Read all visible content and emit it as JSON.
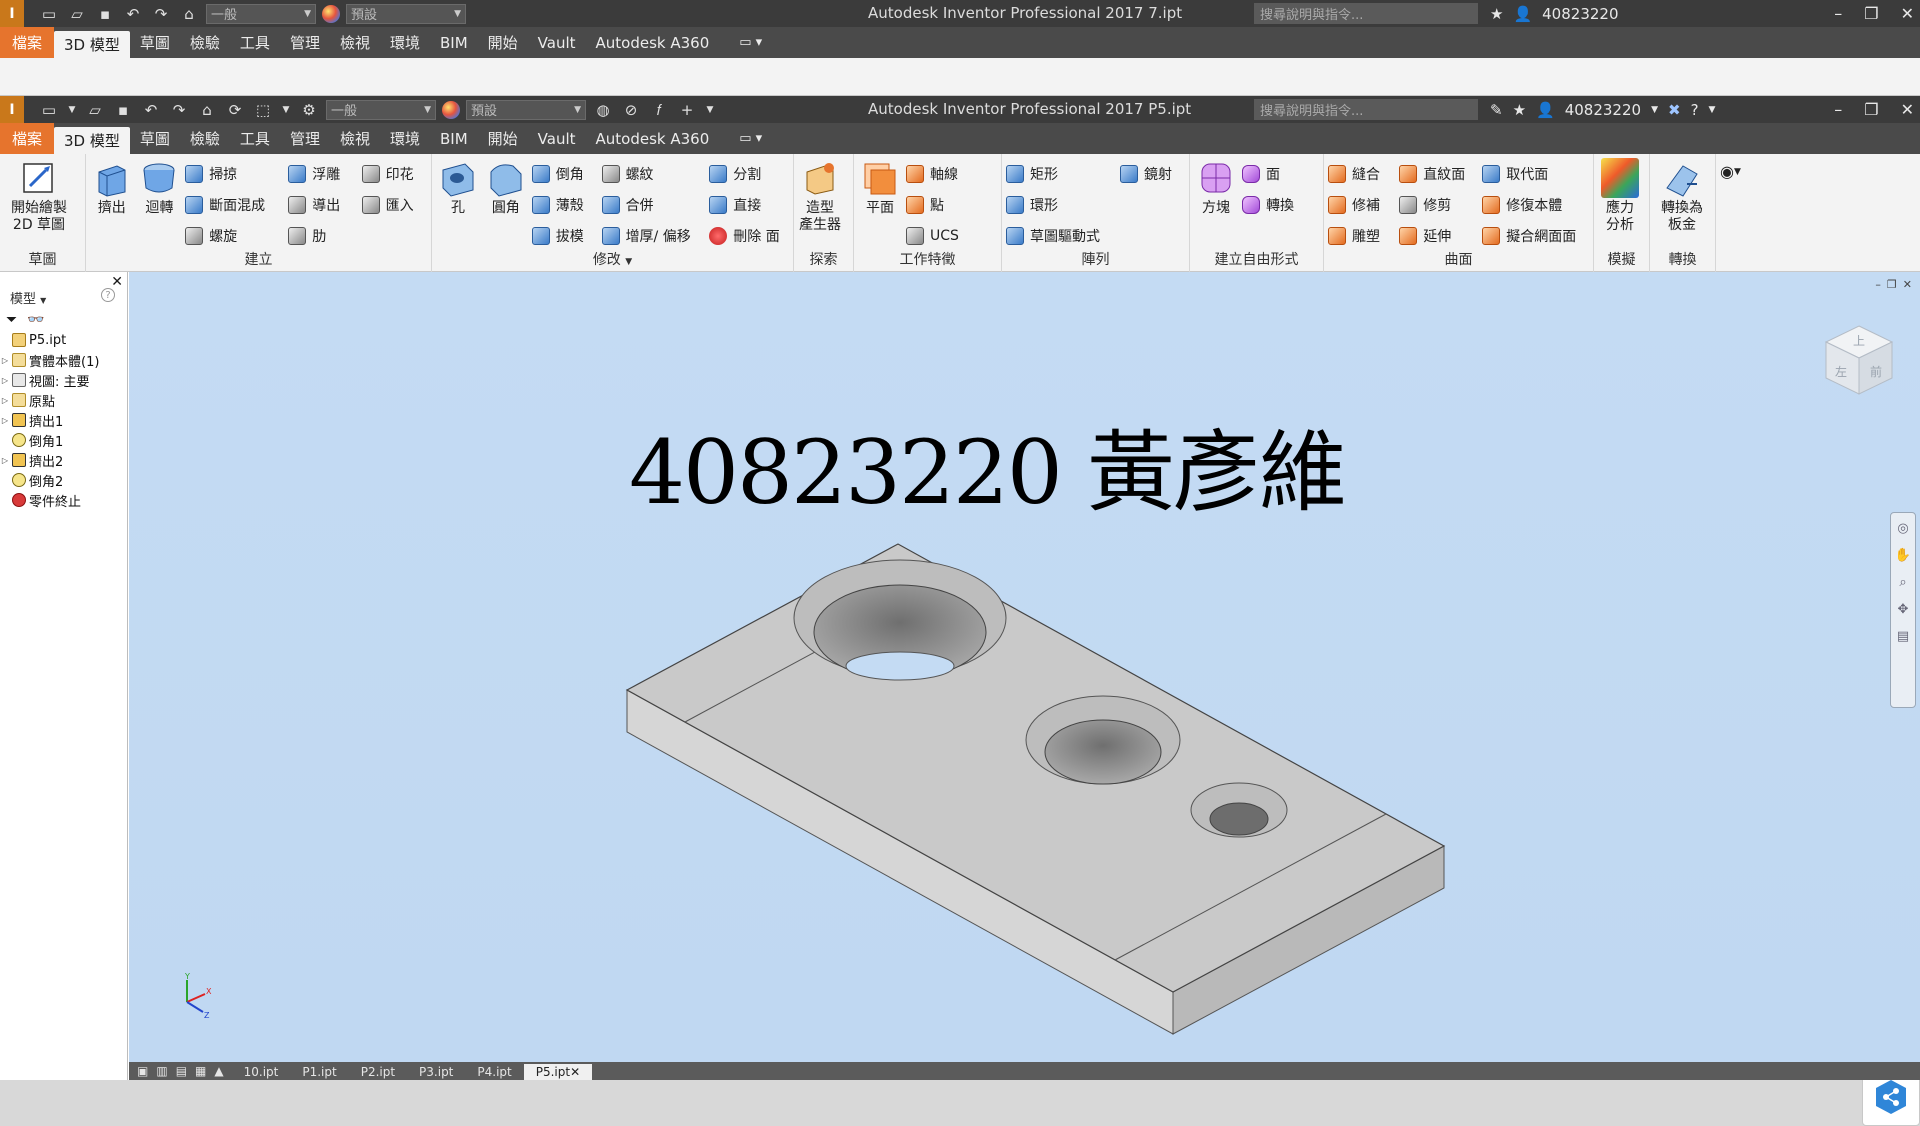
{
  "titlebar": {
    "style_value": "一般",
    "appearance_value": "預設",
    "help_search_placeholder": "搜尋說明與指令...",
    "username": "40823220"
  },
  "ghost_window": {
    "title": "Autodesk Inventor Professional 2017    7.ipt"
  },
  "window": {
    "title": "Autodesk Inventor Professional 2017    P5.ipt"
  },
  "menu_tabs": [
    "檔案",
    "3D 模型",
    "草圖",
    "檢驗",
    "工具",
    "管理",
    "檢視",
    "環境",
    "BIM",
    "開始",
    "Vault",
    "Autodesk A360"
  ],
  "ribbon": {
    "sketch": {
      "title": "草圖",
      "start_2d_sketch": "開始繪製\n2D 草圖"
    },
    "create": {
      "title": "建立",
      "extrude": "擠出",
      "revolve": "迴轉",
      "sweep": "掃掠",
      "loft": "斷面混成",
      "coil": "螺旋",
      "emboss": "浮雕",
      "derive": "導出",
      "rib": "肋",
      "decal": "印花",
      "import": "匯入"
    },
    "modify": {
      "title": "修改",
      "hole": "孔",
      "fillet": "圓角",
      "chamfer": "倒角",
      "shell": "薄殼",
      "draft": "拔模",
      "thread": "螺紋",
      "combine": "合併",
      "thicken_offset": "增厚/ 偏移",
      "split": "分割",
      "direct": "直接",
      "delete_face": "刪除 面"
    },
    "explore": {
      "title": "探索",
      "shape_generator": "造型\n產生器"
    },
    "work_features": {
      "title": "工作特徵",
      "plane": "平面",
      "axis": "軸線",
      "point": "點",
      "ucs": "UCS"
    },
    "pattern": {
      "title": "陣列",
      "rectangular": "矩形",
      "circular": "環形",
      "sketch_driven": "草圖驅動式",
      "mirror": "鏡射"
    },
    "freeform": {
      "title": "建立自由形式",
      "box": "方塊",
      "face": "面",
      "convert": "轉換"
    },
    "surface": {
      "title": "曲面",
      "stitch": "縫合",
      "patch": "修補",
      "sculpt": "雕塑",
      "ruled_surface": "直紋面",
      "trim": "修剪",
      "extend": "延伸",
      "replace_face": "取代面",
      "repair_bodies": "修復本體",
      "fit_mesh_face": "擬合網面面"
    },
    "simulation": {
      "title": "模擬",
      "stress_analysis": "應力\n分析"
    },
    "convert": {
      "title": "轉換",
      "convert_sheet_metal": "轉換為\n板金"
    }
  },
  "browser": {
    "header": "模型",
    "tree": [
      {
        "label": "P5.ipt",
        "icon": "part-doc-icon",
        "expander": false
      },
      {
        "label": "實體本體(1)",
        "icon": "folder-icon",
        "expander": true
      },
      {
        "label": "視圖: 主要",
        "icon": "view-rep-icon",
        "expander": true
      },
      {
        "label": "原點",
        "icon": "folder-icon",
        "expander": true
      },
      {
        "label": "擠出1",
        "icon": "extrude-icon",
        "expander": true
      },
      {
        "label": "倒角1",
        "icon": "chamfer-icon",
        "expander": false
      },
      {
        "label": "擠出2",
        "icon": "extrude-icon",
        "expander": true
      },
      {
        "label": "倒角2",
        "icon": "chamfer-icon",
        "expander": false
      },
      {
        "label": "零件終止",
        "icon": "end-of-part-icon",
        "expander": false
      }
    ]
  },
  "viewport": {
    "overlay_text": "40823220 黃彥維",
    "viewcube_labels": {
      "top": "上",
      "left": "左",
      "front": "前"
    }
  },
  "doc_tabs": [
    "10.ipt",
    "P1.ipt",
    "P2.ipt",
    "P3.ipt",
    "P4.ipt",
    "P5.ipt"
  ],
  "colors": {
    "file_tab": "#e6742d",
    "titlebar": "#3b3b3b",
    "viewport_bg": "#c4dbf3",
    "part_face": "#c8c8c8"
  }
}
